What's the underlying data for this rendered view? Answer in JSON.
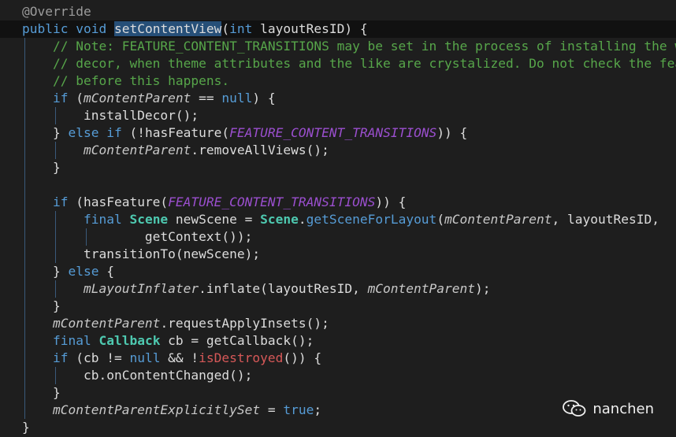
{
  "editor": {
    "lines": [
      [
        {
          "t": "@Override",
          "c": "an"
        }
      ],
      [
        {
          "t": "public",
          "c": "kw"
        },
        {
          "t": " "
        },
        {
          "t": "void",
          "c": "kw"
        },
        {
          "t": " "
        },
        {
          "t": "setContentView",
          "c": "sel"
        },
        {
          "t": "("
        },
        {
          "t": "int",
          "c": "kw"
        },
        {
          "t": " layoutResID) {"
        }
      ],
      [
        {
          "t": "    "
        },
        {
          "t": "// Note: FEATURE_CONTENT_TRANSITIONS may be set in the process of installing the window",
          "c": "cm"
        }
      ],
      [
        {
          "t": "    "
        },
        {
          "t": "// decor, when theme attributes and the like are crystalized. Do not check the feature",
          "c": "cm"
        }
      ],
      [
        {
          "t": "    "
        },
        {
          "t": "// before this happens.",
          "c": "cm"
        }
      ],
      [
        {
          "t": "    "
        },
        {
          "t": "if",
          "c": "kw"
        },
        {
          "t": " ("
        },
        {
          "t": "mContentParent",
          "c": "fld"
        },
        {
          "t": " == "
        },
        {
          "t": "null",
          "c": "kw"
        },
        {
          "t": ") {"
        }
      ],
      [
        {
          "t": "        installDecor();"
        }
      ],
      [
        {
          "t": "    } "
        },
        {
          "t": "else",
          "c": "kw"
        },
        {
          "t": " "
        },
        {
          "t": "if",
          "c": "kw"
        },
        {
          "t": " (!hasFeature("
        },
        {
          "t": "FEATURE_CONTENT_TRANSITIONS",
          "c": "cst"
        },
        {
          "t": ")) {"
        }
      ],
      [
        {
          "t": "        "
        },
        {
          "t": "mContentParent",
          "c": "fld"
        },
        {
          "t": ".removeAllViews();"
        }
      ],
      [
        {
          "t": "    }"
        }
      ],
      [
        {
          "t": ""
        }
      ],
      [
        {
          "t": "    "
        },
        {
          "t": "if",
          "c": "kw"
        },
        {
          "t": " (hasFeature("
        },
        {
          "t": "FEATURE_CONTENT_TRANSITIONS",
          "c": "cst"
        },
        {
          "t": ")) {"
        }
      ],
      [
        {
          "t": "        "
        },
        {
          "t": "final",
          "c": "kw"
        },
        {
          "t": " "
        },
        {
          "t": "Scene",
          "c": "ty"
        },
        {
          "t": " newScene = "
        },
        {
          "t": "Scene",
          "c": "ty"
        },
        {
          "t": "."
        },
        {
          "t": "getSceneForLayout",
          "c": "static-m"
        },
        {
          "t": "("
        },
        {
          "t": "mContentParent",
          "c": "fld"
        },
        {
          "t": ", layoutResID,"
        }
      ],
      [
        {
          "t": "                getContext());"
        }
      ],
      [
        {
          "t": "        transitionTo(newScene);"
        }
      ],
      [
        {
          "t": "    } "
        },
        {
          "t": "else",
          "c": "kw"
        },
        {
          "t": " {"
        }
      ],
      [
        {
          "t": "        "
        },
        {
          "t": "mLayoutInflater",
          "c": "fld"
        },
        {
          "t": ".inflate(layoutResID, "
        },
        {
          "t": "mContentParent",
          "c": "fld"
        },
        {
          "t": ");"
        }
      ],
      [
        {
          "t": "    }"
        }
      ],
      [
        {
          "t": "    "
        },
        {
          "t": "mContentParent",
          "c": "fld"
        },
        {
          "t": ".requestApplyInsets();"
        }
      ],
      [
        {
          "t": "    "
        },
        {
          "t": "final",
          "c": "kw"
        },
        {
          "t": " "
        },
        {
          "t": "Callback",
          "c": "ty"
        },
        {
          "t": " cb = getCallback();"
        }
      ],
      [
        {
          "t": "    "
        },
        {
          "t": "if",
          "c": "kw"
        },
        {
          "t": " (cb != "
        },
        {
          "t": "null",
          "c": "kw"
        },
        {
          "t": " && !"
        },
        {
          "t": "isDestroyed",
          "c": "err"
        },
        {
          "t": "()) {"
        }
      ],
      [
        {
          "t": "        cb.onContentChanged();"
        }
      ],
      [
        {
          "t": "    }"
        }
      ],
      [
        {
          "t": "    "
        },
        {
          "t": "mContentParentExplicitlySet",
          "c": "fld"
        },
        {
          "t": " = "
        },
        {
          "t": "true",
          "c": "kw"
        },
        {
          "t": ";"
        }
      ],
      [
        {
          "t": "}"
        }
      ]
    ]
  },
  "watermark": {
    "text": "nanchen",
    "icon": "wechat-icon"
  },
  "colors": {
    "background": "#1e1e1e",
    "keyword": "#569cd6",
    "comment": "#57a64a",
    "type": "#4ec9b0",
    "constant": "#9b4fcf",
    "selection": "#264f78"
  }
}
